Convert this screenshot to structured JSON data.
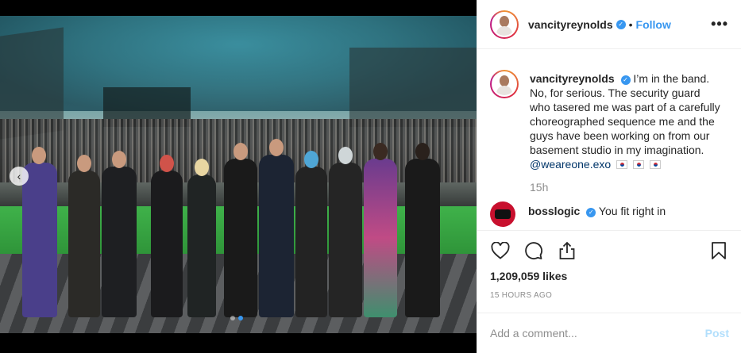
{
  "post": {
    "username": "vancityreynolds",
    "separator": "•",
    "follow_label": "Follow",
    "more_label": "•••",
    "caption": {
      "username": "vancityreynolds",
      "text": "I’m in the band. No, for serious. The security guard who tasered me was part of a carefully choreographed sequence me and the guys have been working on from our basement studio in my imagination.",
      "mention": "@weareone.exo",
      "age": "15h"
    },
    "comment": {
      "username": "bosslogic",
      "text": "You fit right in"
    },
    "likes": "1,209,059 likes",
    "timestamp": "15 HOURS AGO",
    "add_comment_placeholder": "Add a comment...",
    "post_label": "Post"
  },
  "icons": {
    "verified": "verified-badge-icon",
    "like": "heart-icon",
    "comment": "comment-icon",
    "share": "share-icon",
    "save": "bookmark-icon",
    "prev": "chevron-left-icon"
  },
  "colors": {
    "accent": "#3897f0",
    "post_disabled": "#b2dffc",
    "muted": "#8e8e8e"
  },
  "carousel": {
    "slides": 2,
    "active_index": 1
  }
}
